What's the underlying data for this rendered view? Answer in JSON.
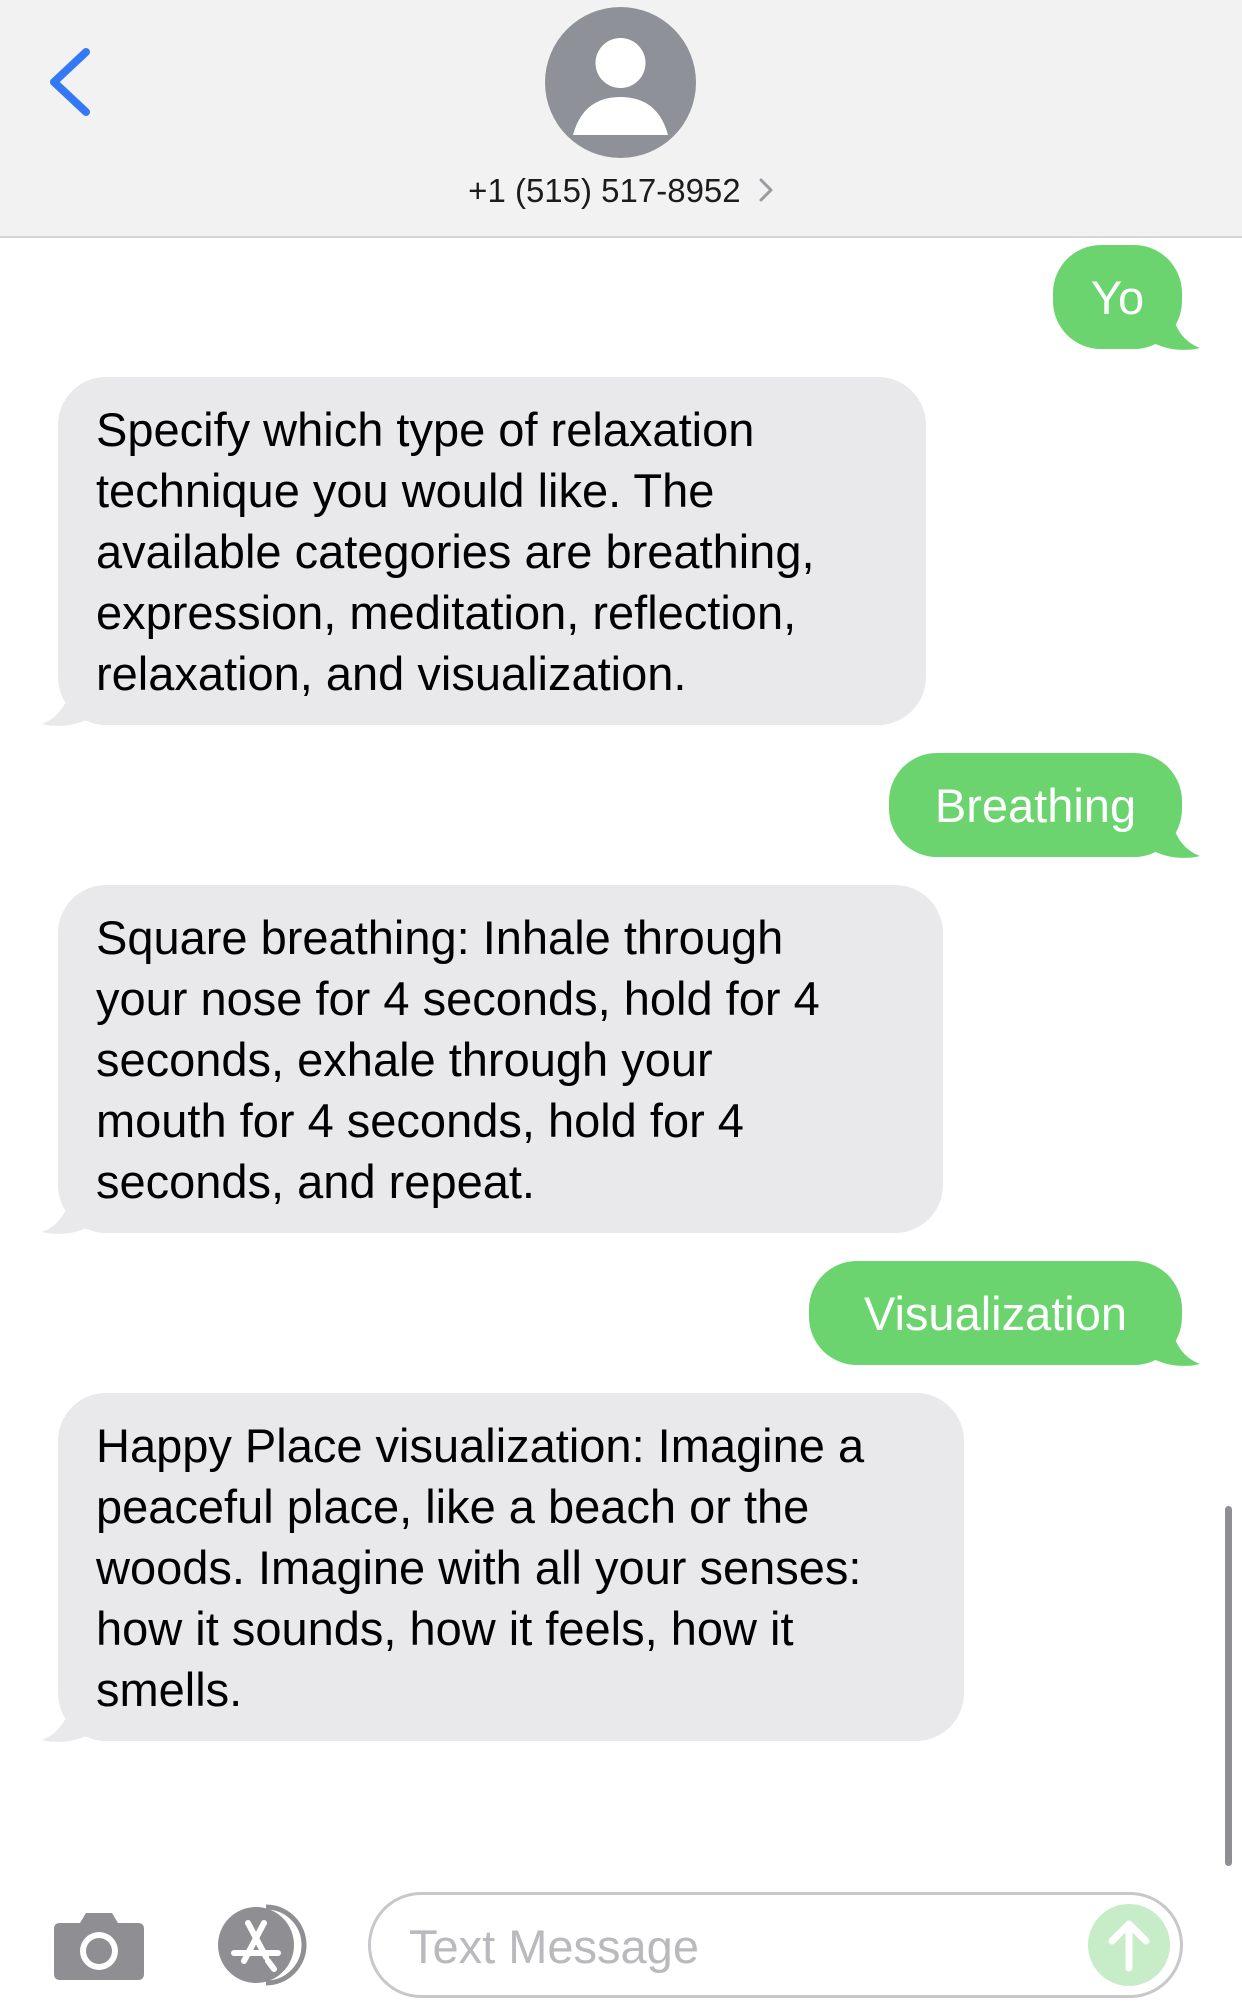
{
  "header": {
    "contact_label": "+1 (515) 517-8952"
  },
  "messages": [
    {
      "direction": "sent",
      "text": "Yo"
    },
    {
      "direction": "received",
      "text": "Specify which type of relaxation\ntechnique you would like. The\navailable categories are breathing,\nexpression, meditation, reflection,\nrelaxation, and visualization."
    },
    {
      "direction": "sent",
      "text": "Breathing"
    },
    {
      "direction": "received",
      "text": "Square breathing: Inhale through\nyour nose for 4 seconds, hold for 4\nseconds, exhale through your\nmouth for 4 seconds, hold for 4\nseconds, and repeat."
    },
    {
      "direction": "sent",
      "text": "Visualization"
    },
    {
      "direction": "received",
      "text": "Happy Place visualization: Imagine a\npeaceful place, like a beach or the\nwoods. Imagine with all your senses:\nhow it sounds, how it feels, how it\nsmells."
    }
  ],
  "compose": {
    "placeholder": "Text Message",
    "value": ""
  },
  "icons": {
    "back": "chevron-left-icon",
    "avatar": "person-icon",
    "contact_disclosure": "chevron-right-icon",
    "camera": "camera-icon",
    "appstore": "app-store-icon",
    "send": "arrow-up-icon"
  },
  "colors": {
    "accent_blue": "#3478f6",
    "sent_bubble": "#6bd46f",
    "received_bubble": "#e9e9eb",
    "header_bg": "#f2f2f3",
    "send_button_disabled": "#c6ecc8"
  }
}
